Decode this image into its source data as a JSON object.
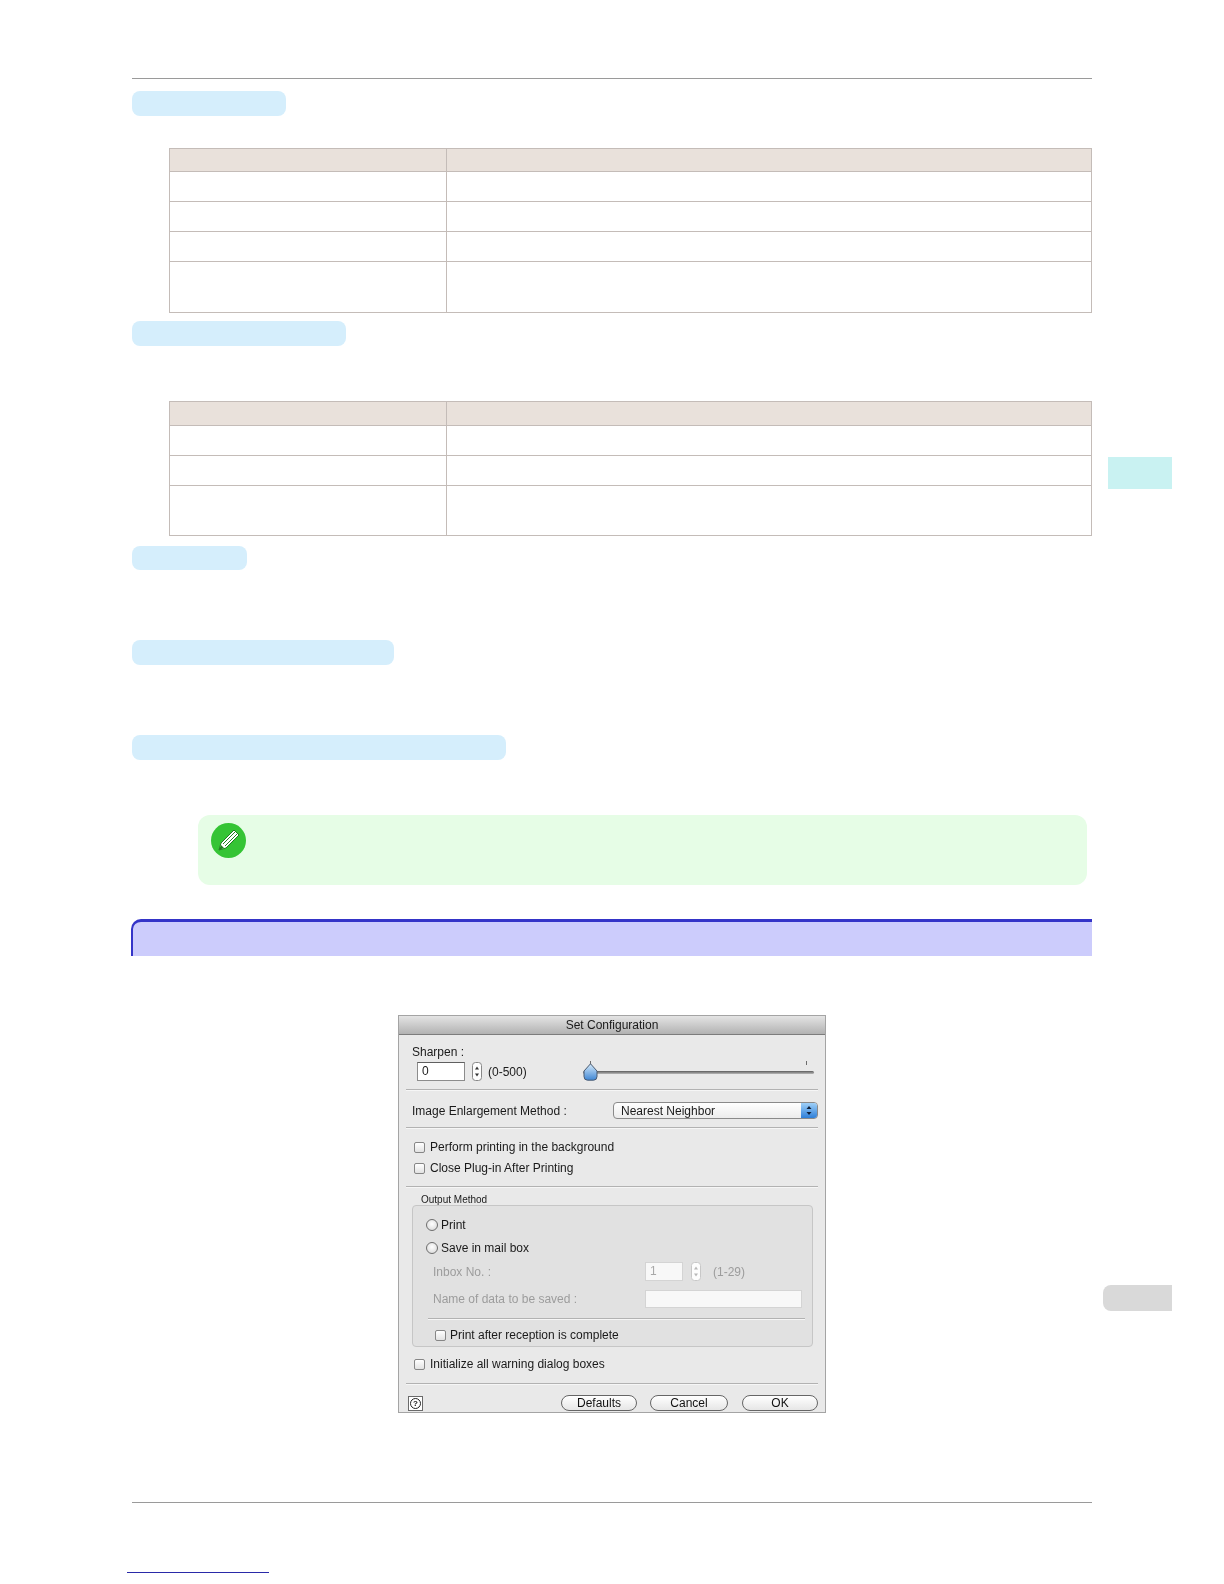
{
  "dialog": {
    "title": "Set Configuration",
    "sharpen": {
      "label": "Sharpen :",
      "value": "0",
      "range": "(0-500)",
      "level": 0
    },
    "enlargement": {
      "label": "Image Enlargement Method :",
      "value": "Nearest Neighbor"
    },
    "options": [
      {
        "label": "Perform printing in the background",
        "checked": false
      },
      {
        "label": "Close Plug-in After Printing",
        "checked": false
      }
    ],
    "output_method": {
      "title": "Output Method",
      "choices": [
        {
          "label": "Print",
          "selected": false
        },
        {
          "label": "Save in mail box",
          "selected": false
        }
      ],
      "fields": [
        {
          "kind": "stepper",
          "label": "Inbox No. :",
          "value": "1",
          "range": "(1-29)",
          "disabled": true
        },
        {
          "kind": "text",
          "label": "Name of data to be saved :",
          "disabled": true
        }
      ],
      "options": [
        {
          "label": "Print after reception is complete",
          "checked": false
        }
      ]
    },
    "final_options": [
      {
        "label": "Initialize all warning dialog boxes",
        "checked": false
      }
    ],
    "help": "?",
    "buttons": [
      "Defaults",
      "Cancel",
      "OK"
    ]
  }
}
